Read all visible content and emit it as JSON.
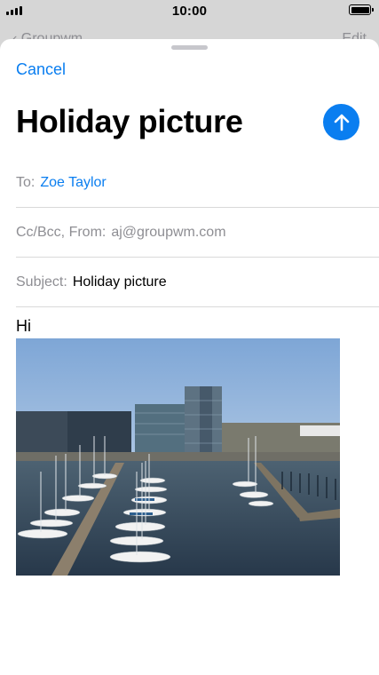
{
  "status_bar": {
    "time": "10:00",
    "battery_level": 1.0
  },
  "background_screen": {
    "back_label": "Groupwm",
    "edit_label": "Edit"
  },
  "compose": {
    "cancel_label": "Cancel",
    "title": "Holiday picture",
    "to": {
      "label": "To:",
      "value": "Zoe Taylor"
    },
    "cc": {
      "label": "Cc/Bcc, From:",
      "value": "aj@groupwm.com"
    },
    "subject": {
      "label": "Subject:",
      "value": "Holiday picture"
    },
    "body_text": "Hi"
  },
  "colors": {
    "accent": "#0a7ef0",
    "secondary_text": "#8e8e93",
    "separator": "#d9d9d9"
  },
  "icons": {
    "send": "arrow-up-icon",
    "back": "chevron-left-icon"
  }
}
